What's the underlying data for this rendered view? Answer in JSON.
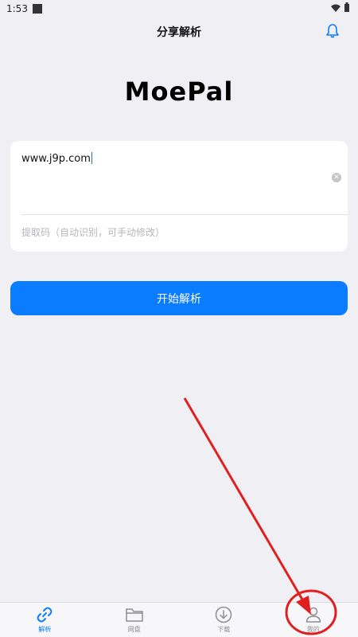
{
  "status_bar": {
    "time": "1:53"
  },
  "header": {
    "title": "分享解析",
    "notification_icon": "bell-icon"
  },
  "logo": {
    "text": "MoePal"
  },
  "form": {
    "url_value": "www.j9p.com",
    "code_placeholder": "提取码（自动识别，可手动修改）",
    "clear_icon": "clear-icon"
  },
  "actions": {
    "start_label": "开始解析"
  },
  "tabs": [
    {
      "label": "解析",
      "icon": "link-icon",
      "active": true
    },
    {
      "label": "网盘",
      "icon": "folder-icon",
      "active": false
    },
    {
      "label": "下载",
      "icon": "download-icon",
      "active": false
    },
    {
      "label": "我的",
      "icon": "user-icon",
      "active": false
    }
  ],
  "colors": {
    "accent": "#0a7cff",
    "annotation": "#e02020",
    "background": "#efeff4"
  }
}
